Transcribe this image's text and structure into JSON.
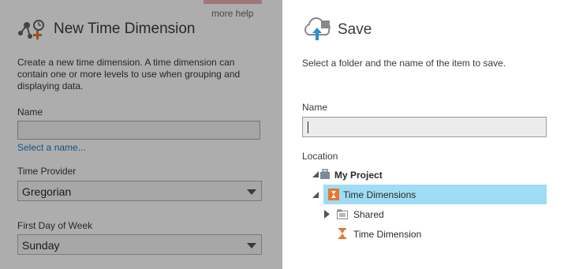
{
  "left_panel": {
    "more_help": "more help",
    "title": "New Time Dimension",
    "description": "Create a new time dimension. A time dimension can contain one or more levels to use when grouping and displaying data.",
    "name_label": "Name",
    "name_value": "",
    "select_name_link": "Select a name...",
    "time_provider_label": "Time Provider",
    "time_provider_value": "Gregorian",
    "first_day_label": "First Day of Week",
    "first_day_value": "Sunday"
  },
  "save_dialog": {
    "title": "Save",
    "description": "Select a folder and the name of the item to save.",
    "name_label": "Name",
    "name_value": "",
    "location_label": "Location",
    "tree": [
      {
        "label": "My Project",
        "expanded": true,
        "selected": false,
        "bold": true,
        "icon": "project-icon"
      },
      {
        "label": "Time Dimensions",
        "expanded": true,
        "selected": true,
        "bold": false,
        "icon": "time-dimension-folder-icon"
      },
      {
        "label": "Shared",
        "expanded": false,
        "selected": false,
        "bold": false,
        "icon": "shared-folder-icon"
      },
      {
        "label": "Time Dimension",
        "expanded": false,
        "selected": false,
        "bold": false,
        "icon": "hourglass-icon"
      }
    ]
  },
  "colors": {
    "selection": "#9fdcf5",
    "link": "#1e7ac2",
    "accent_orange": "#e8772e",
    "cloud_blue": "#2a8fd6"
  }
}
